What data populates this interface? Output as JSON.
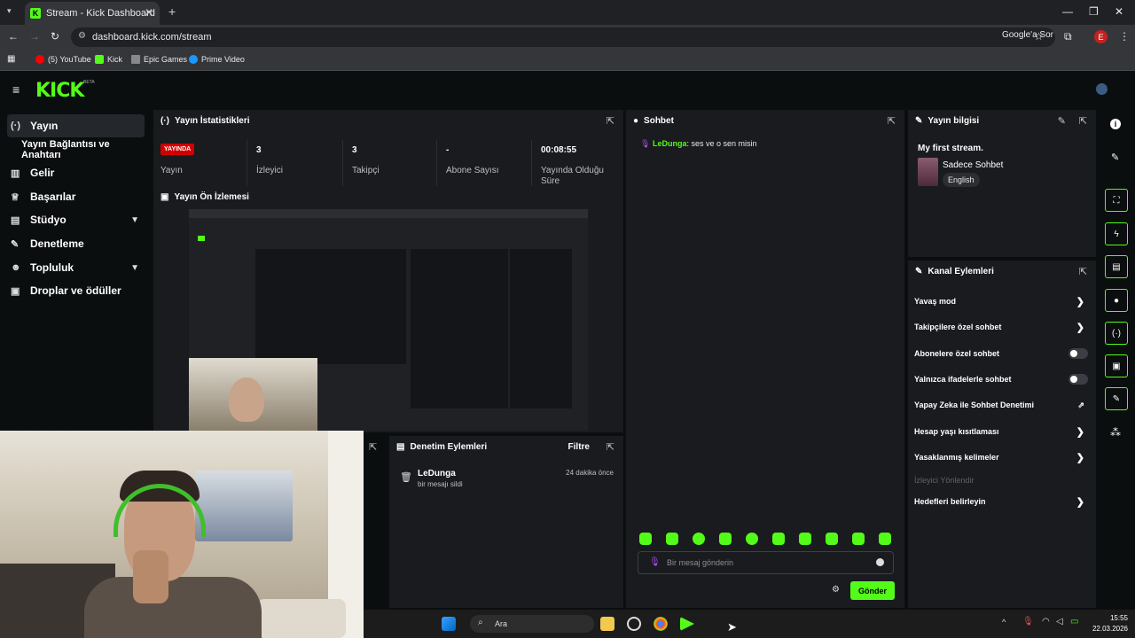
{
  "browser": {
    "tab_title": "Stream - Kick Dashboard",
    "url": "dashboard.kick.com/stream",
    "google_ask": "Google'a Sor",
    "profile_initial": "E",
    "bookmarks": [
      "(5) YouTube",
      "Kick",
      "Epic Games",
      "Prime Video"
    ]
  },
  "brand": {
    "logo": "KICK",
    "beta": "BETA"
  },
  "sidebar": {
    "items": [
      {
        "label": "Yayın",
        "icon": "broadcast-icon"
      },
      {
        "label": "Yayın Bağlantısı ve Anahtarı"
      },
      {
        "label": "Gelir",
        "icon": "revenue-icon"
      },
      {
        "label": "Başarılar",
        "icon": "trophy-icon"
      },
      {
        "label": "Stüdyo",
        "icon": "studio-icon"
      },
      {
        "label": "Denetleme",
        "icon": "wrench-icon"
      },
      {
        "label": "Topluluk",
        "icon": "community-icon"
      },
      {
        "label": "Droplar ve ödüller",
        "icon": "gift-icon"
      }
    ]
  },
  "stats": {
    "title": "Yayın İstatistikleri",
    "live_badge": "YAYINDA",
    "live_label": "Yayın",
    "viewers_value": "3",
    "viewers_label": "İzleyici",
    "followers_value": "3",
    "followers_label": "Takipçi",
    "subs_value": "-",
    "subs_label": "Abone Sayısı",
    "uptime_value": "00:08:55",
    "uptime_label": "Yayında Olduğu Süre"
  },
  "preview": {
    "title": "Yayın Ön İzlemesi"
  },
  "mod_actions": {
    "title": "Denetim Eylemleri",
    "filter": "Filtre",
    "entry_user": "LeDunga",
    "entry_action": "bir mesajı sildi",
    "entry_time": "24 dakika önce"
  },
  "chat": {
    "title": "Sohbet",
    "message_user": "LeDunga",
    "message_text": ": ses ve o sen misin",
    "input_placeholder": "Bir mesaj gönderin",
    "send_label": "Gönder"
  },
  "stream_info": {
    "title": "Yayın bilgisi",
    "stream_title": "My first stream.",
    "category": "Sadece Sohbet",
    "language": "English"
  },
  "channel_actions": {
    "title": "Kanal Eylemleri",
    "items": [
      {
        "label": "Yavaş mod",
        "control": "chevron"
      },
      {
        "label": "Takipçilere özel sohbet",
        "control": "chevron"
      },
      {
        "label": "Abonelere özel sohbet",
        "control": "toggle"
      },
      {
        "label": "Yalnızca ifadelerle sohbet",
        "control": "toggle"
      },
      {
        "label": "Yapay Zeka ile Sohbet Denetimi",
        "control": "external"
      },
      {
        "label": "Hesap yaşı kısıtlaması",
        "control": "chevron"
      },
      {
        "label": "Yasaklanmış kelimeler",
        "control": "chevron"
      },
      {
        "label": "İzleyici Yönlendir",
        "control": "disabled"
      },
      {
        "label": "Hedefleri belirleyin",
        "control": "chevron"
      }
    ]
  },
  "taskbar": {
    "search": "Ara",
    "time": "15:55",
    "date": "22.03.2026"
  },
  "colors": {
    "accent": "#53fc18",
    "live": "#d10000",
    "panel": "#191b1f",
    "bg": "#0b0e0f"
  }
}
